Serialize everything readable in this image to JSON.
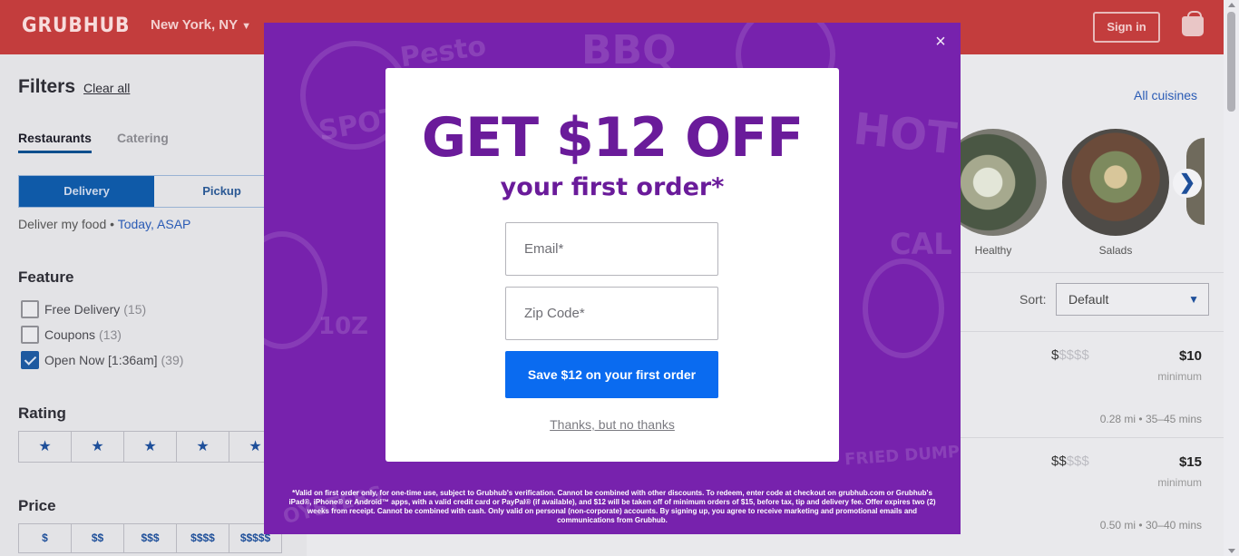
{
  "header": {
    "logo": "GRUBHUB",
    "location": "New York, NY",
    "sign_in": "Sign in",
    "bag_icon": "shopping-bag-icon"
  },
  "sidebar": {
    "title": "Filters",
    "clear_all": "Clear all",
    "tabs": [
      {
        "label": "Restaurants",
        "active": true
      },
      {
        "label": "Catering",
        "active": false
      }
    ],
    "order_type": [
      {
        "label": "Delivery",
        "active": true
      },
      {
        "label": "Pickup",
        "active": false
      }
    ],
    "deliver_prefix": "Deliver my food •",
    "deliver_time": "Today, ASAP",
    "feature_heading": "Feature",
    "features": [
      {
        "label": "Free Delivery",
        "count": "(15)",
        "checked": false
      },
      {
        "label": "Coupons",
        "count": "(13)",
        "checked": false
      },
      {
        "label": "Open Now [1:36am]",
        "count": "(39)",
        "checked": true
      }
    ],
    "rating_heading": "Rating",
    "rating_star": "★",
    "price_heading": "Price",
    "price_options": [
      "$",
      "$$",
      "$$$",
      "$$$$",
      "$$$$$"
    ]
  },
  "main": {
    "all_cuisines": "All cuisines",
    "cuisines": [
      {
        "label": "Healthy"
      },
      {
        "label": "Salads"
      }
    ],
    "carousel_next": "❯",
    "sort_label": "Sort:",
    "sort_value": "Default",
    "restaurants": [
      {
        "price_on": "$",
        "price_off": "$$$$",
        "minimum": "$10",
        "minimum_label": "minimum",
        "meta": "0.28 mi • 35–45 mins"
      },
      {
        "price_on": "$$",
        "price_off": "$$$",
        "minimum": "$15",
        "minimum_label": "minimum",
        "meta": "0.50 mi • 30–40 mins"
      }
    ]
  },
  "modal": {
    "close": "×",
    "title": "GET $12 OFF",
    "subtitle": "your first order*",
    "email_placeholder": "Email*",
    "zip_placeholder": "Zip Code*",
    "submit": "Save $12 on your first order",
    "decline": "Thanks, but no thanks",
    "disclaimer": "*Valid on first order only, for one-time use, subject to Grubhub's verification. Cannot be combined with other discounts. To redeem, enter code at checkout on grubhub.com or Grubhub's iPad®, iPhone® or Android™ apps, with a valid credit card or PayPal® (if available), and $12 will be taken off of minimum orders of $15, before tax, tip and delivery fee. Offer expires two (2) weeks from receipt. Cannot be combined with cash. Only valid on personal (non-corporate) accounts. By signing up, you agree to receive marketing and promotional emails and communications from Grubhub.",
    "background_doodles": [
      "Pesto",
      "BBQ",
      "HOT",
      "SPOT",
      "CAL",
      "FRIED DUMPLINGS",
      "OYSTERS",
      "10Z"
    ],
    "colors": {
      "background": "#7722ad",
      "title": "#6a1b9a",
      "button": "#0a6bf0"
    }
  }
}
